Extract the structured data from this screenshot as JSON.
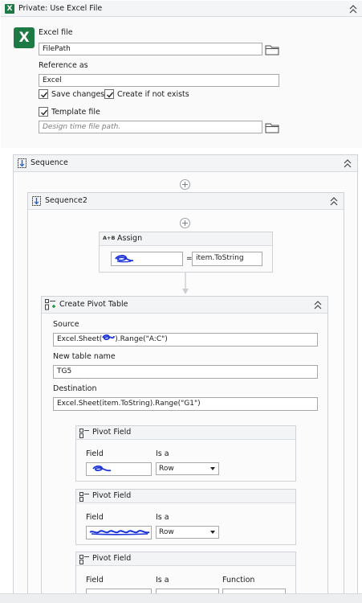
{
  "use_excel": {
    "title": "Private: Use Excel File",
    "excel_file_label": "Excel file",
    "excel_file_value": "FilePath",
    "reference_as_label": "Reference as",
    "reference_as_value": "Excel",
    "save_changes_label": "Save changes",
    "create_if_not_exists_label": "Create if not exists",
    "template_file_label": "Template file",
    "template_placeholder": "Design time file path.",
    "icon_letter": "X"
  },
  "sequence": {
    "title": "Sequence"
  },
  "sequence2": {
    "title": "Sequence2"
  },
  "assign": {
    "icon_text": "A+B",
    "title": "Assign",
    "equals": "=",
    "value": "item.ToString"
  },
  "pivot_table": {
    "title": "Create Pivot Table",
    "source_label": "Source",
    "source_prefix": "Excel.Sheet(",
    "source_suffix": ").Range(\"A:C\")",
    "new_table_name_label": "New table name",
    "new_table_name_value": "TG5",
    "destination_label": "Destination",
    "destination_value": "Excel.Sheet(item.ToString).Range(\"G1\")"
  },
  "pivot_fields": [
    {
      "title": "Pivot Field",
      "field_label": "Field",
      "is_a_label": "Is a",
      "is_a_value": "Row"
    },
    {
      "title": "Pivot Field",
      "field_label": "Field",
      "is_a_label": "Is a",
      "is_a_value": "Row"
    },
    {
      "title": "Pivot Field",
      "field_label": "Field",
      "is_a_label": "Is a",
      "function_label": "Function"
    }
  ],
  "colors": {
    "excel_green": "#1e7a45",
    "scribble_blue": "#1a33d6",
    "border": "#cfd3d8"
  }
}
